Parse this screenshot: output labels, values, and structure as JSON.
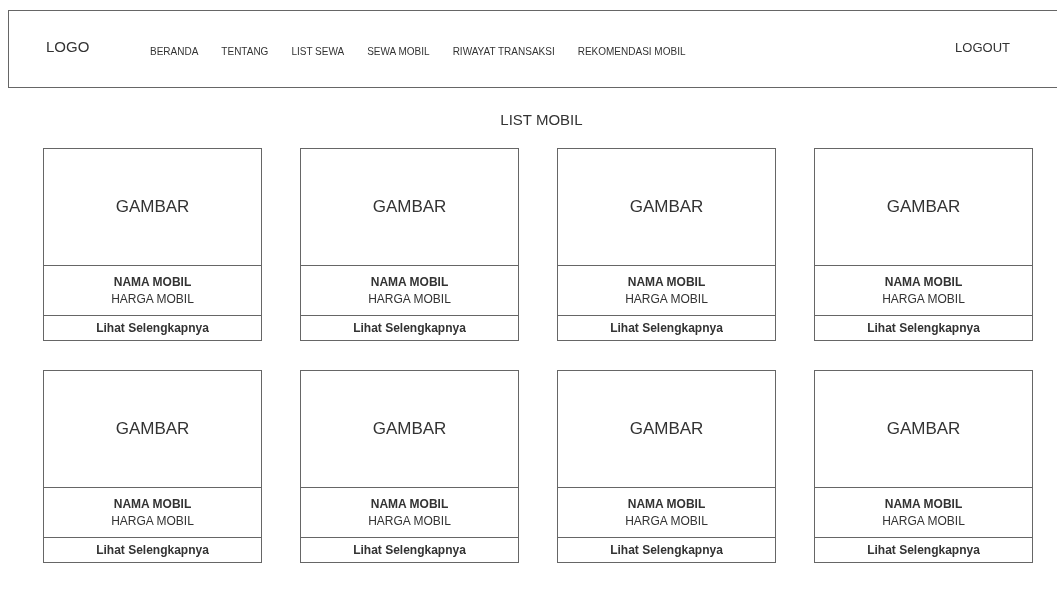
{
  "header": {
    "logo": "LOGO",
    "nav_items": [
      {
        "label": "BERANDA"
      },
      {
        "label": "TENTANG"
      },
      {
        "label": "LIST SEWA"
      },
      {
        "label": "SEWA MOBIL"
      },
      {
        "label": "RIWAYAT TRANSAKSI"
      },
      {
        "label": "REKOMENDASI MOBIL"
      }
    ],
    "logout": "LOGOUT"
  },
  "title": "LIST MOBIL",
  "cars": [
    {
      "image": "GAMBAR",
      "name": "NAMA MOBIL",
      "price": "HARGA MOBIL",
      "link": "Lihat Selengkapnya"
    },
    {
      "image": "GAMBAR",
      "name": "NAMA MOBIL",
      "price": "HARGA MOBIL",
      "link": "Lihat Selengkapnya"
    },
    {
      "image": "GAMBAR",
      "name": "NAMA MOBIL",
      "price": "HARGA MOBIL",
      "link": "Lihat Selengkapnya"
    },
    {
      "image": "GAMBAR",
      "name": "NAMA MOBIL",
      "price": "HARGA MOBIL",
      "link": "Lihat Selengkapnya"
    },
    {
      "image": "GAMBAR",
      "name": "NAMA MOBIL",
      "price": "HARGA MOBIL",
      "link": "Lihat Selengkapnya"
    },
    {
      "image": "GAMBAR",
      "name": "NAMA MOBIL",
      "price": "HARGA MOBIL",
      "link": "Lihat Selengkapnya"
    },
    {
      "image": "GAMBAR",
      "name": "NAMA MOBIL",
      "price": "HARGA MOBIL",
      "link": "Lihat Selengkapnya"
    },
    {
      "image": "GAMBAR",
      "name": "NAMA MOBIL",
      "price": "HARGA MOBIL",
      "link": "Lihat Selengkapnya"
    }
  ]
}
